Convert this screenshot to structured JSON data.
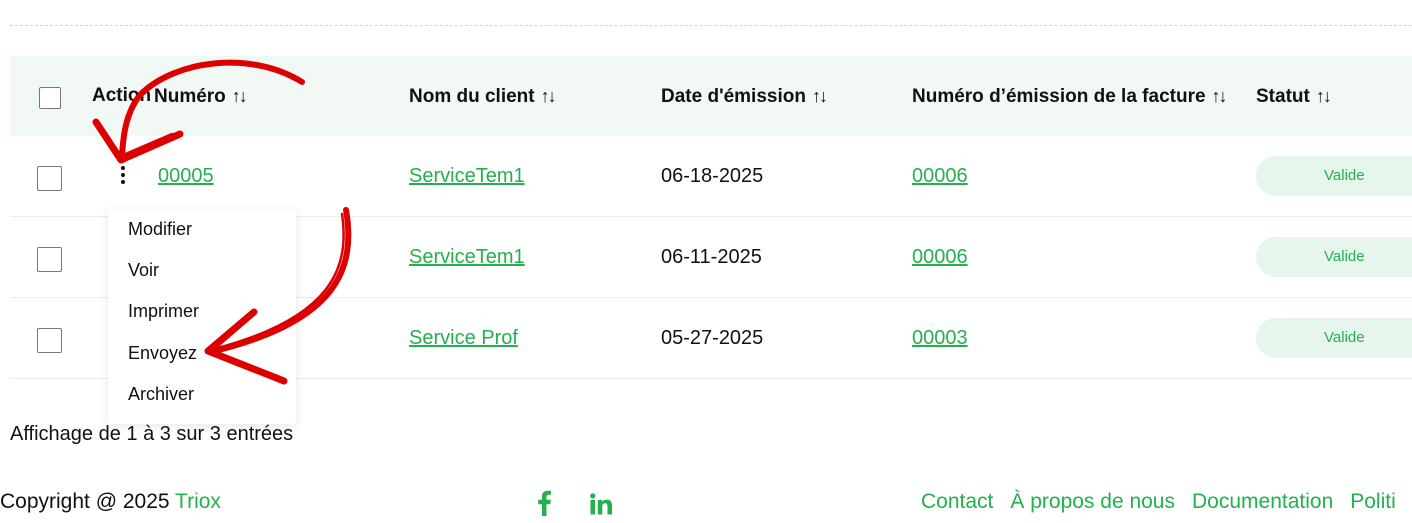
{
  "table": {
    "headers": {
      "action": "Action",
      "numero": "Numéro",
      "client": "Nom du client",
      "date": "Date d'émission",
      "invoice_number": "Numéro d’émission de la facture",
      "status": "Statut",
      "sort_icon": "↑↓"
    },
    "rows": [
      {
        "numero": "00005",
        "client": "ServiceTem1",
        "date": "06-18-2025",
        "invoice_number": "00006",
        "status": "Valide"
      },
      {
        "numero": "",
        "client": "ServiceTem1",
        "date": "06-11-2025",
        "invoice_number": "00006",
        "status": "Valide"
      },
      {
        "numero": "",
        "client": "Service Prof",
        "date": "05-27-2025",
        "invoice_number": "00003",
        "status": "Valide"
      }
    ]
  },
  "action_menu": {
    "items": [
      "Modifier",
      "Voir",
      "Imprimer",
      "Envoyez",
      "Archiver"
    ]
  },
  "summary": "Affichage de 1 à 3 sur 3 entrées",
  "footer": {
    "copyright_prefix": "Copyright @ 2025 ",
    "brand": "Triox",
    "social": [
      "facebook-icon",
      "linkedin-icon"
    ],
    "links": [
      "Contact",
      "À propos de nous",
      "Documentation",
      "Politi"
    ]
  },
  "colors": {
    "accent": "#22b14c",
    "header_bg": "#f2f8f4",
    "badge_bg": "#e6f6ec",
    "annotation_arrow": "#dd0000"
  }
}
